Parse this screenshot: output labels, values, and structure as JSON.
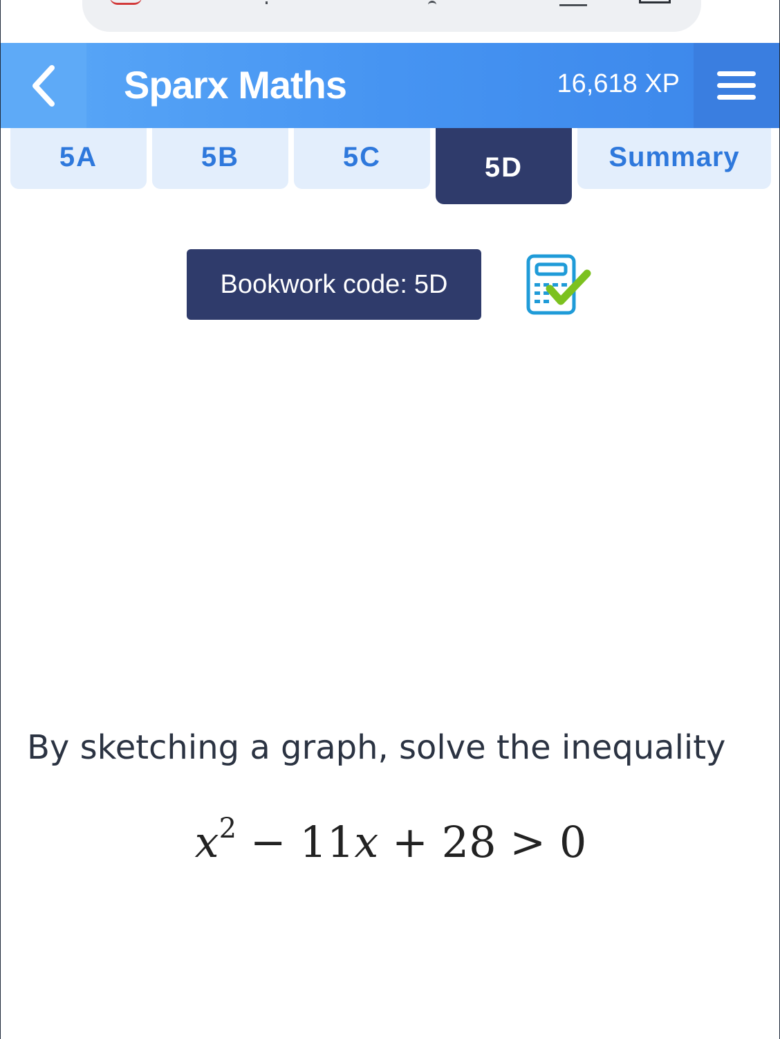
{
  "header": {
    "title": "Sparx Maths",
    "xp": "16,618 XP"
  },
  "tabs": [
    {
      "label": "5A",
      "active": false
    },
    {
      "label": "5B",
      "active": false
    },
    {
      "label": "5C",
      "active": false
    },
    {
      "label": "5D",
      "active": true
    },
    {
      "label": "Summary",
      "active": false
    }
  ],
  "bookwork": {
    "label": "Bookwork code:",
    "code": "5D"
  },
  "question": {
    "prompt": "By sketching a graph, solve the inequality",
    "expression": {
      "var": "x",
      "exponent": "2",
      "rest_a": " − 11",
      "var2": "x",
      "rest_b": " + 28 > 0"
    }
  },
  "colors": {
    "header_blue": "#4694f2",
    "tab_bg": "#e3eefc",
    "tab_active": "#2f3b6b",
    "accent_green": "#7cc11f"
  },
  "icons": [
    "back-chevron-icon",
    "menu-icon",
    "calculator-check-icon"
  ]
}
